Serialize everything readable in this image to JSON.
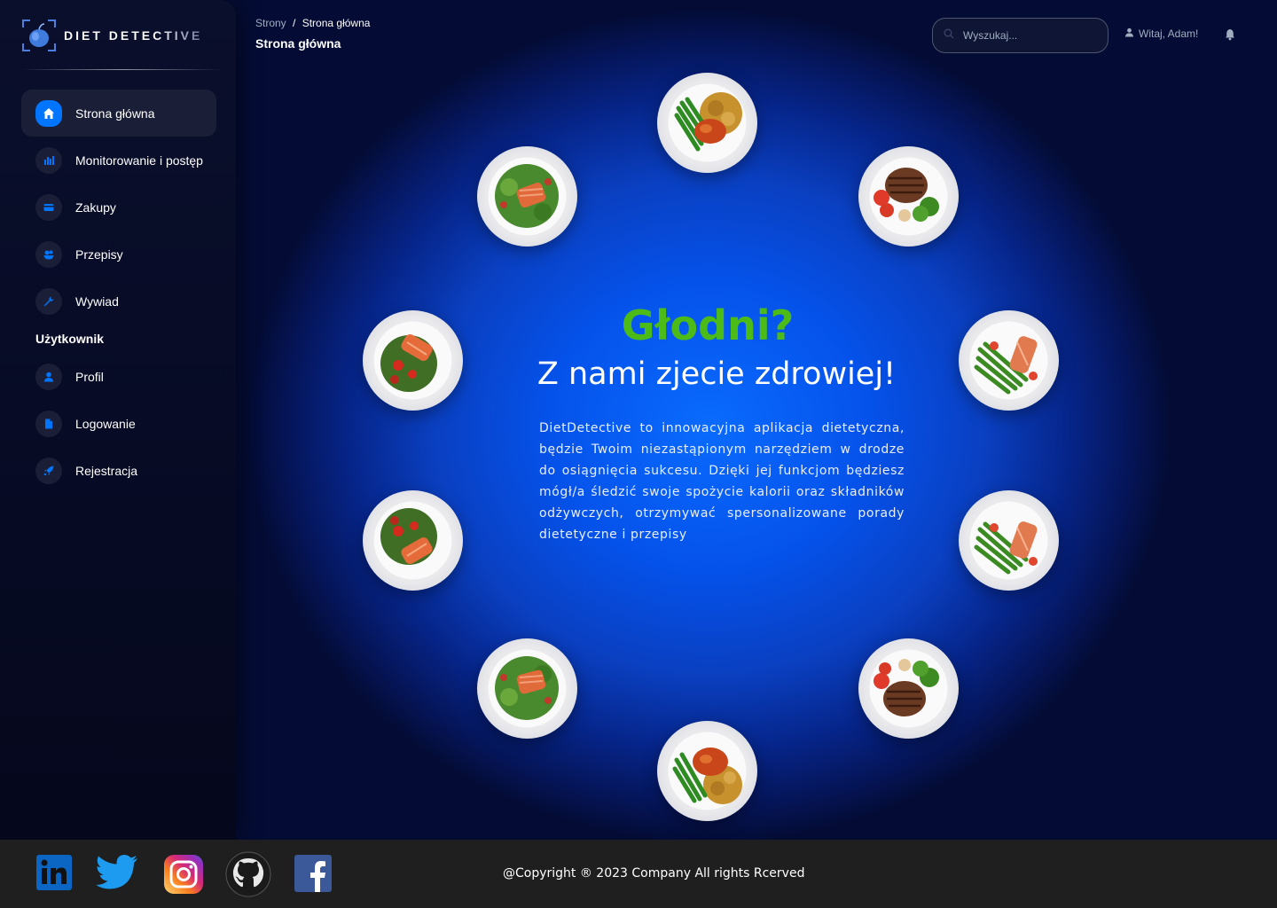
{
  "app": {
    "name": "DIET DETECTIVE"
  },
  "header": {
    "breadcrumb_root": "Strony",
    "breadcrumb_sep": "/",
    "breadcrumb_current": "Strona główna",
    "page_title": "Strona główna",
    "search_placeholder": "Wyszukaj...",
    "greeting": "Witaj, Adam!"
  },
  "sidebar": {
    "items": [
      {
        "label": "Strona główna",
        "icon": "home-icon",
        "active": true
      },
      {
        "label": "Monitorowanie i postęp",
        "icon": "chart-icon"
      },
      {
        "label": "Zakupy",
        "icon": "credit-card-icon"
      },
      {
        "label": "Przepisy",
        "icon": "recipe-icon"
      },
      {
        "label": "Wywiad",
        "icon": "wrench-icon"
      }
    ],
    "user_section_label": "Użytkownik",
    "user_items": [
      {
        "label": "Profil",
        "icon": "person-icon"
      },
      {
        "label": "Logowanie",
        "icon": "document-icon"
      },
      {
        "label": "Rejestracja",
        "icon": "rocket-icon"
      }
    ]
  },
  "hero": {
    "title": "Głodni?",
    "subtitle": "Z nami zjecie zdrowiej!",
    "description": "DietDetective to innowacyjna aplikacja dietetyczna, będzie Twoim niezastąpionym narzędziem w drodze do osiągnięcia sukcesu. Dzięki jej funkcjom będziesz mógł/a śledzić swoje spożycie kalorii oraz składników odżywczych, otrzymywać spersonalizowane porady dietetyczne i przepisy"
  },
  "plates": [
    "chicken-rice-beans",
    "steak-broccoli",
    "salmon-asparagus",
    "salmon-asparagus",
    "steak-broccoli",
    "chicken-rice-beans",
    "salmon-salad",
    "salmon-salad",
    "salmon-salad",
    "salmon-salad"
  ],
  "footer": {
    "social": [
      "linkedin-icon",
      "twitter-icon",
      "instagram-icon",
      "github-icon",
      "facebook-icon"
    ],
    "copyright": "@Copyright ® 2023 Company All rights Rcerved"
  },
  "colors": {
    "accent": "#0075ff",
    "hero_title": "#4cbb17",
    "sidebar_bg": "#0a0f2c",
    "footer_bg": "#1f1f1f"
  }
}
